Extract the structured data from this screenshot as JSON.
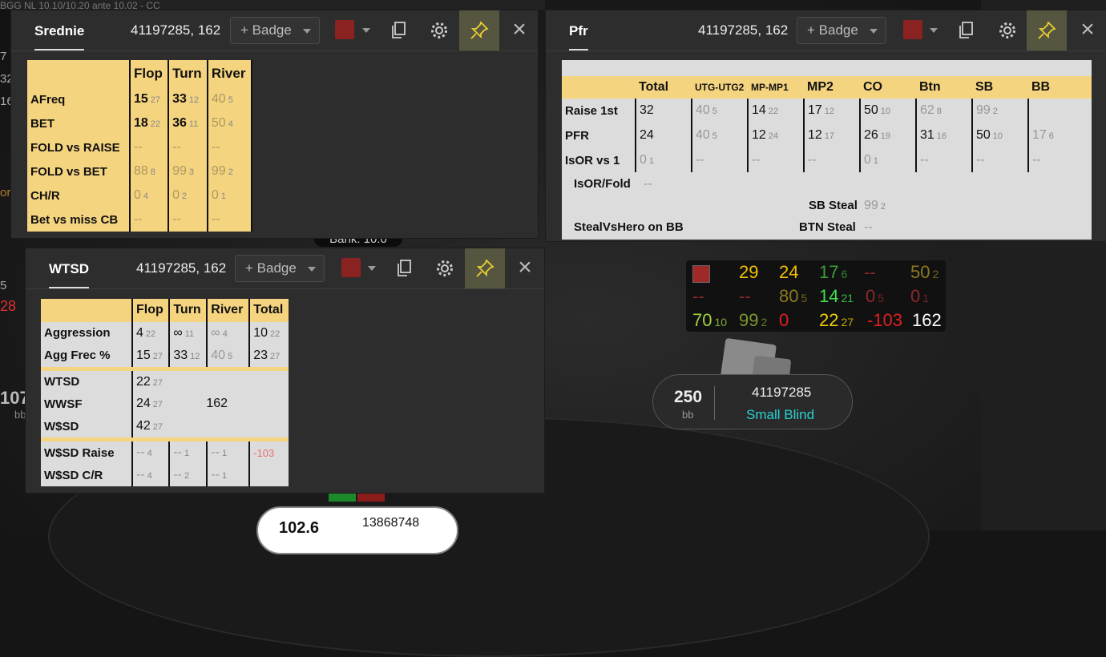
{
  "background": {
    "top_strip": "BGG NL 10.10/10.20 ante 10.02 - CC",
    "bank_label": "Bank: 10.0",
    "left_fragments": [
      "7",
      "32",
      "16",
      "or",
      "5",
      "28",
      "107",
      "bb"
    ],
    "bottom_seat": {
      "stack": "102.6",
      "id": "13868748"
    }
  },
  "srednie": {
    "tab": "Srednie",
    "player": "41197285, 162",
    "badge": "+ Badge",
    "columns": [
      "Flop",
      "Turn",
      "River"
    ],
    "rows": [
      {
        "label": "AFreq",
        "cells": [
          [
            "15",
            "27"
          ],
          [
            "33",
            "12"
          ],
          [
            "40",
            "5"
          ]
        ]
      },
      {
        "label": "BET",
        "cells": [
          [
            "18",
            "22"
          ],
          [
            "36",
            "11"
          ],
          [
            "50",
            "4"
          ]
        ]
      },
      {
        "label": "FOLD vs RAISE",
        "cells": [
          [
            "--",
            ""
          ],
          [
            "--",
            ""
          ],
          [
            "--",
            ""
          ]
        ]
      },
      {
        "label": "FOLD vs BET",
        "cells": [
          [
            "88",
            "8"
          ],
          [
            "99",
            "3"
          ],
          [
            "99",
            "2"
          ]
        ]
      },
      {
        "label": "CH/R",
        "cells": [
          [
            "0",
            "4"
          ],
          [
            "0",
            "2"
          ],
          [
            "0",
            "1"
          ]
        ]
      },
      {
        "label": "Bet vs miss CB",
        "cells": [
          [
            "--",
            ""
          ],
          [
            "--",
            ""
          ],
          [
            "--",
            ""
          ]
        ]
      }
    ]
  },
  "pfr": {
    "tab": "Pfr",
    "player": "41197285, 162",
    "badge": "+ Badge",
    "columns": [
      "Total",
      "UTG-UTG2",
      "MP-MP1",
      "MP2",
      "CO",
      "Btn",
      "SB",
      "BB"
    ],
    "rows": [
      {
        "label": "Raise 1st",
        "cells": [
          [
            "32",
            ""
          ],
          [
            "40",
            "5"
          ],
          [
            "14",
            "22"
          ],
          [
            "17",
            "12"
          ],
          [
            "50",
            "10"
          ],
          [
            "62",
            "8"
          ],
          [
            "99",
            "2"
          ],
          [
            "",
            ""
          ]
        ]
      },
      {
        "label": "PFR",
        "cells": [
          [
            "24",
            ""
          ],
          [
            "40",
            "5"
          ],
          [
            "12",
            "24"
          ],
          [
            "12",
            "17"
          ],
          [
            "26",
            "19"
          ],
          [
            "31",
            "16"
          ],
          [
            "50",
            "10"
          ],
          [
            "17",
            "6"
          ]
        ]
      },
      {
        "label": "IsOR vs 1",
        "cells": [
          [
            "0",
            "1"
          ],
          [
            "--",
            ""
          ],
          [
            "--",
            ""
          ],
          [
            "--",
            ""
          ],
          [
            "0",
            "1"
          ],
          [
            "--",
            ""
          ],
          [
            "--",
            ""
          ],
          [
            "--",
            ""
          ]
        ]
      }
    ],
    "isor_fold": {
      "label": "IsOR/Fold",
      "value": "--"
    },
    "sb_steal": {
      "label": "SB Steal",
      "value": "99",
      "sample": "2"
    },
    "steal_vs_hero": {
      "label": "StealVsHero on BB",
      "value": ""
    },
    "btn_steal": {
      "label": "BTN Steal",
      "value": "--"
    }
  },
  "wtsd": {
    "tab": "WTSD",
    "player": "41197285, 162",
    "badge": "+ Badge",
    "columns": [
      "Flop",
      "Turn",
      "River",
      "Total"
    ],
    "agg_rows": [
      {
        "label": "Aggression",
        "cells": [
          [
            "4",
            "22"
          ],
          [
            "∞",
            "11"
          ],
          [
            "∞",
            "4"
          ],
          [
            "10",
            "22"
          ]
        ]
      },
      {
        "label": "Agg Frec %",
        "cells": [
          [
            "15",
            "27"
          ],
          [
            "33",
            "12"
          ],
          [
            "40",
            "5"
          ],
          [
            "23",
            "27"
          ]
        ]
      }
    ],
    "wtsd": {
      "label": "WTSD",
      "value": "22",
      "sample": "27"
    },
    "wwsf": {
      "label": "WWSF",
      "value": "24",
      "sample": "27",
      "extra": "162"
    },
    "wsd": {
      "label": "W$SD",
      "value": "42",
      "sample": "27"
    },
    "wsd_rows": [
      {
        "label": "W$SD Raise",
        "cells": [
          [
            "--",
            "4"
          ],
          [
            "--",
            "1"
          ],
          [
            "--",
            "1"
          ],
          [
            "-103",
            ""
          ]
        ]
      },
      {
        "label": "W$SD C/R",
        "cells": [
          [
            "--",
            "4"
          ],
          [
            "--",
            "2"
          ],
          [
            "--",
            "1"
          ],
          [
            "",
            ""
          ]
        ]
      }
    ]
  },
  "hud": {
    "row1": [
      [
        "29",
        ""
      ],
      [
        "24",
        ""
      ],
      [
        "17",
        "6"
      ],
      [
        "--",
        ""
      ],
      [
        "50",
        "2"
      ]
    ],
    "row2": [
      [
        "--",
        ""
      ],
      [
        "--",
        ""
      ],
      [
        "80",
        "5"
      ],
      [
        "14",
        "21"
      ],
      [
        "0",
        "5"
      ],
      [
        "0",
        "1"
      ]
    ],
    "row3": [
      [
        "70",
        "10"
      ],
      [
        "99",
        "2"
      ],
      [
        "0",
        ""
      ],
      [
        "22",
        "27"
      ],
      [
        "-103",
        ""
      ],
      [
        "162",
        ""
      ]
    ]
  },
  "seat": {
    "stack": "250",
    "unit": "bb",
    "player_id": "41197285",
    "position": "Small Blind"
  },
  "colors": {
    "header_yellow": "#f5d480",
    "body_gray": "#dcdcdc",
    "pin_active": "#565640",
    "swatch": "#8b2222",
    "accent_cyan": "#2ad1d1"
  }
}
